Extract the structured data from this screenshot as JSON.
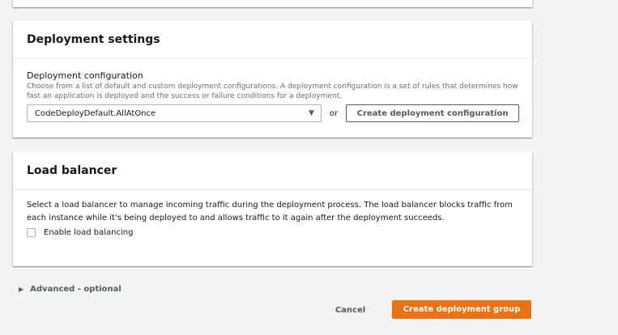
{
  "deployment_settings": {
    "title": "Deployment settings",
    "config_label": "Deployment configuration",
    "config_description": "Choose from a list of default and custom deployment configurations. A deployment configuration is a set of rules that determines how fast an application is deployed and the success or failure conditions for a deployment.",
    "config_selected": "CodeDeployDefault.AllAtOnce",
    "or_text": "or",
    "create_config_button": "Create deployment configuration"
  },
  "load_balancer": {
    "title": "Load balancer",
    "description": "Select a load balancer to manage incoming traffic during the deployment process. The load balancer blocks traffic from each instance while it's being deployed to and allows traffic to it again after the deployment succeeds.",
    "checkbox_label": "Enable load balancing",
    "checkbox_checked": false
  },
  "advanced": {
    "label": "Advanced - optional"
  },
  "footer": {
    "cancel_label": "Cancel",
    "submit_label": "Create deployment group"
  },
  "colors": {
    "primary": "#ec7211",
    "background": "#f2f3f3",
    "text": "#16191f",
    "muted": "#687078"
  }
}
